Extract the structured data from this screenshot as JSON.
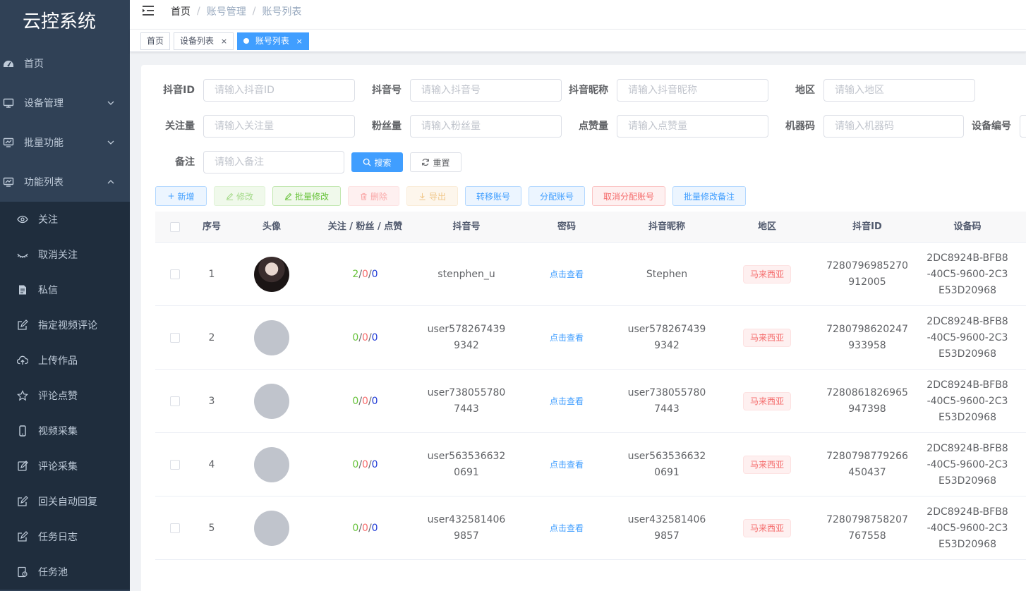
{
  "sidebar": {
    "title": "云控系统",
    "menu": [
      {
        "label": "首页",
        "icon": "dashboard-icon"
      },
      {
        "label": "设备管理",
        "icon": "monitor-icon"
      },
      {
        "label": "批量功能",
        "icon": "chart-icon"
      },
      {
        "label": "功能列表",
        "icon": "chart-icon"
      }
    ],
    "submenu": [
      {
        "label": "关注",
        "icon": "eye-icon"
      },
      {
        "label": "取消关注",
        "icon": "eye-closed-icon"
      },
      {
        "label": "私信",
        "icon": "document-icon"
      },
      {
        "label": "指定视频评论",
        "icon": "edit-icon"
      },
      {
        "label": "上传作品",
        "icon": "upload-cloud-icon"
      },
      {
        "label": "评论点赞",
        "icon": "star-icon"
      },
      {
        "label": "视频采集",
        "icon": "phone-icon"
      },
      {
        "label": "评论采集",
        "icon": "edit-icon"
      },
      {
        "label": "回关自动回复",
        "icon": "edit-icon"
      },
      {
        "label": "任务日志",
        "icon": "edit-icon"
      },
      {
        "label": "任务池",
        "icon": "pool-icon"
      }
    ]
  },
  "breadcrumb": [
    "首页",
    "账号管理",
    "账号列表"
  ],
  "tags": [
    {
      "label": "首页"
    },
    {
      "label": "设备列表",
      "close": "×"
    },
    {
      "label": "账号列表",
      "close": "×"
    }
  ],
  "form": {
    "douyin_id": {
      "label": "抖音ID",
      "placeholder": "请输入抖音ID"
    },
    "douyin_no": {
      "label": "抖音号",
      "placeholder": "请输入抖音号"
    },
    "nickname": {
      "label": "抖音昵称",
      "placeholder": "请输入抖音昵称"
    },
    "region": {
      "label": "地区",
      "placeholder": "请输入地区"
    },
    "follow": {
      "label": "关注量",
      "placeholder": "请输入关注量"
    },
    "fans": {
      "label": "粉丝量",
      "placeholder": "请输入粉丝量"
    },
    "likes": {
      "label": "点赞量",
      "placeholder": "请输入点赞量"
    },
    "machine": {
      "label": "机器码",
      "placeholder": "请输入机器码"
    },
    "device": {
      "label": "设备编号",
      "placeholder": ""
    },
    "remark": {
      "label": "备注",
      "placeholder": "请输入备注"
    },
    "search_label": "搜索",
    "reset_label": "重置"
  },
  "toolbar": {
    "add": "新增",
    "edit": "修改",
    "batch_edit": "批量修改",
    "delete": "删除",
    "export": "导出",
    "transfer": "转移账号",
    "assign": "分配账号",
    "unassign": "取消分配账号",
    "batch_remark": "批量修改备注"
  },
  "table": {
    "headers": {
      "index": "序号",
      "avatar": "头像",
      "stats": "关注 / 粉丝 / 点赞",
      "douyin_no": "抖音号",
      "password": "密码",
      "nickname": "抖音昵称",
      "region": "地区",
      "douyin_id": "抖音ID",
      "device_code": "设备码"
    },
    "password_link": "点击查看",
    "stat_sep": " / ",
    "rows": [
      {
        "index": "1",
        "follow": "2",
        "fans": "0",
        "likes": "0",
        "douyin_no": "stenphen_u",
        "nickname": "Stephen",
        "region": "马来西亚",
        "douyin_id": "7280796985270912005",
        "device_code": "2DC8924B-BFB8-40C5-9600-2C3E53D20968",
        "has_photo": true
      },
      {
        "index": "2",
        "follow": "0",
        "fans": "0",
        "likes": "0",
        "douyin_no": "user5782674399342",
        "nickname": "user5782674399342",
        "region": "马来西亚",
        "douyin_id": "7280798620247933958",
        "device_code": "2DC8924B-BFB8-40C5-9600-2C3E53D20968",
        "has_photo": false
      },
      {
        "index": "3",
        "follow": "0",
        "fans": "0",
        "likes": "0",
        "douyin_no": "user7380557807443",
        "nickname": "user7380557807443",
        "region": "马来西亚",
        "douyin_id": "7280861826965947398",
        "device_code": "2DC8924B-BFB8-40C5-9600-2C3E53D20968",
        "has_photo": false
      },
      {
        "index": "4",
        "follow": "0",
        "fans": "0",
        "likes": "0",
        "douyin_no": "user5635366320691",
        "nickname": "user5635366320691",
        "region": "马来西亚",
        "douyin_id": "7280798779266450437",
        "device_code": "2DC8924B-BFB8-40C5-9600-2C3E53D20968",
        "has_photo": false
      },
      {
        "index": "5",
        "follow": "0",
        "fans": "0",
        "likes": "0",
        "douyin_no": "user4325814069857",
        "nickname": "user4325814069857",
        "region": "马来西亚",
        "douyin_id": "7280798758207767558",
        "device_code": "2DC8924B-BFB8-40C5-9600-2C3E53D20968",
        "has_photo": false
      }
    ]
  },
  "colors": {
    "sidebar_bg": "#304156",
    "submenu_bg": "#1f2d3d",
    "primary": "#409eff",
    "danger": "#f56c6c",
    "success": "#67c23a"
  }
}
